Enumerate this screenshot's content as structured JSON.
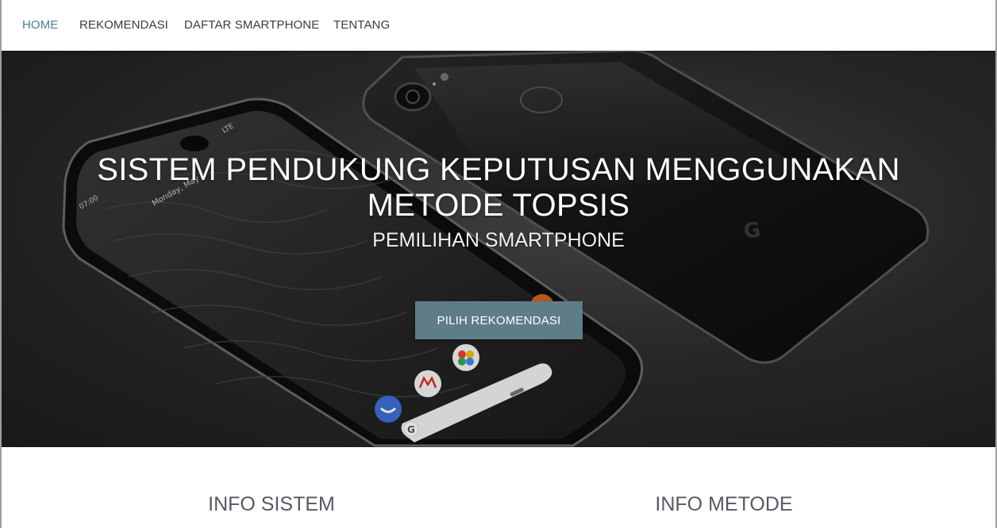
{
  "navbar": {
    "items": [
      {
        "label": "HOME",
        "active": true
      },
      {
        "label": "REKOMENDASI",
        "active": false
      },
      {
        "label": "DAFTAR SMARTPHONE",
        "active": false
      },
      {
        "label": "TENTANG",
        "active": false
      }
    ]
  },
  "hero": {
    "title": "SISTEM PENDUKUNG KEPUTUSAN MENGGUNAKAN METODE TOPSIS",
    "subtitle": "PEMILIHAN SMARTPHONE",
    "cta_label": "PILIH REKOMENDASI",
    "phone_status_time": "07:00",
    "phone_status_net": "LTE",
    "phone_date": "Monday, May"
  },
  "sections": {
    "info_sistem": "INFO SISTEM",
    "info_metode": "INFO METODE"
  },
  "colors": {
    "nav_active": "#4f7c91",
    "cta_background": "#5f7c89",
    "heading_text": "#555a63"
  }
}
